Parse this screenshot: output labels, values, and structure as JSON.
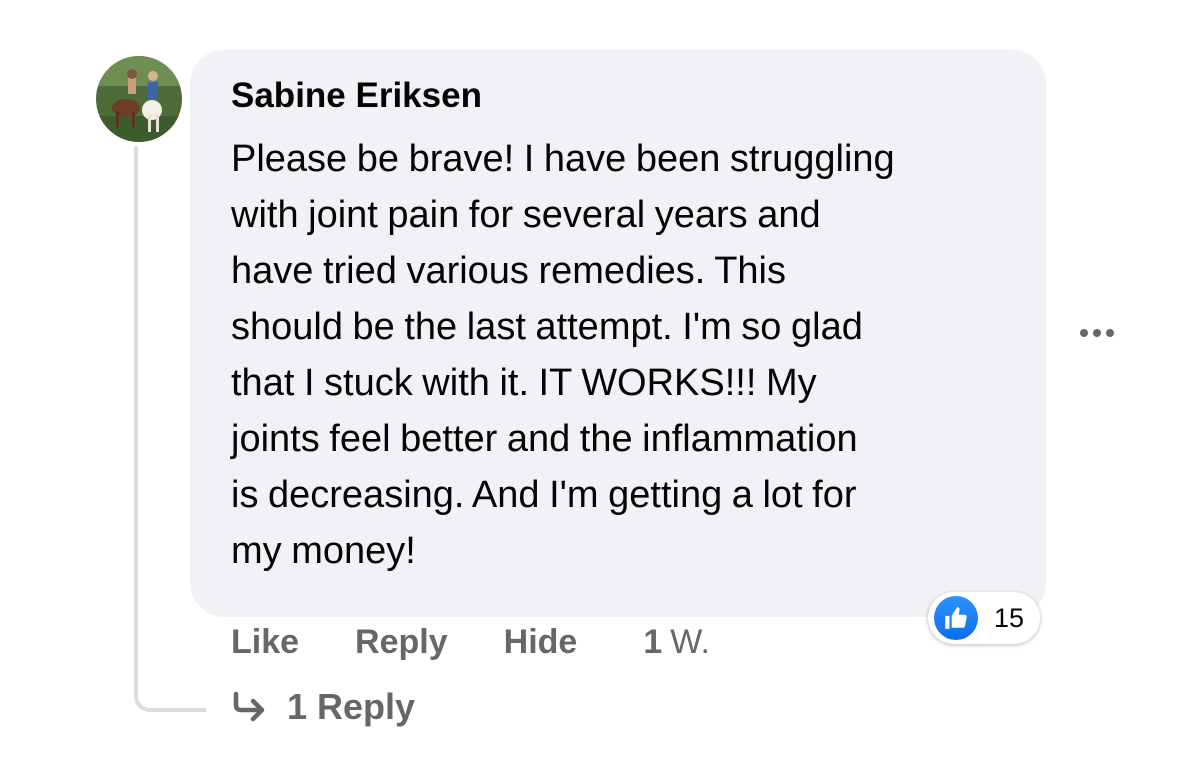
{
  "comment": {
    "author": "Sabine Eriksen",
    "text_lines": [
      "Please be brave! I have been struggling",
      "with joint pain for several years and",
      "have tried various remedies. This",
      "should be the last attempt. I'm so glad",
      "that I stuck with it. IT WORKS!!! My",
      "joints feel better and the inflammation",
      "is decreasing. And I'm getting a lot for",
      "my money!"
    ],
    "avatar_icon": "profile-photo-horse-riders",
    "more_icon": "more-options-dots-icon"
  },
  "reactions": {
    "icon": "thumbs-up-like-icon",
    "count": "15",
    "color": "#1877f2"
  },
  "actions": {
    "like": "Like",
    "reply": "Reply",
    "hide": "Hide",
    "time_number": "1",
    "time_unit": "W."
  },
  "replies": {
    "icon": "reply-arrow-icon",
    "label": "1 Reply"
  }
}
